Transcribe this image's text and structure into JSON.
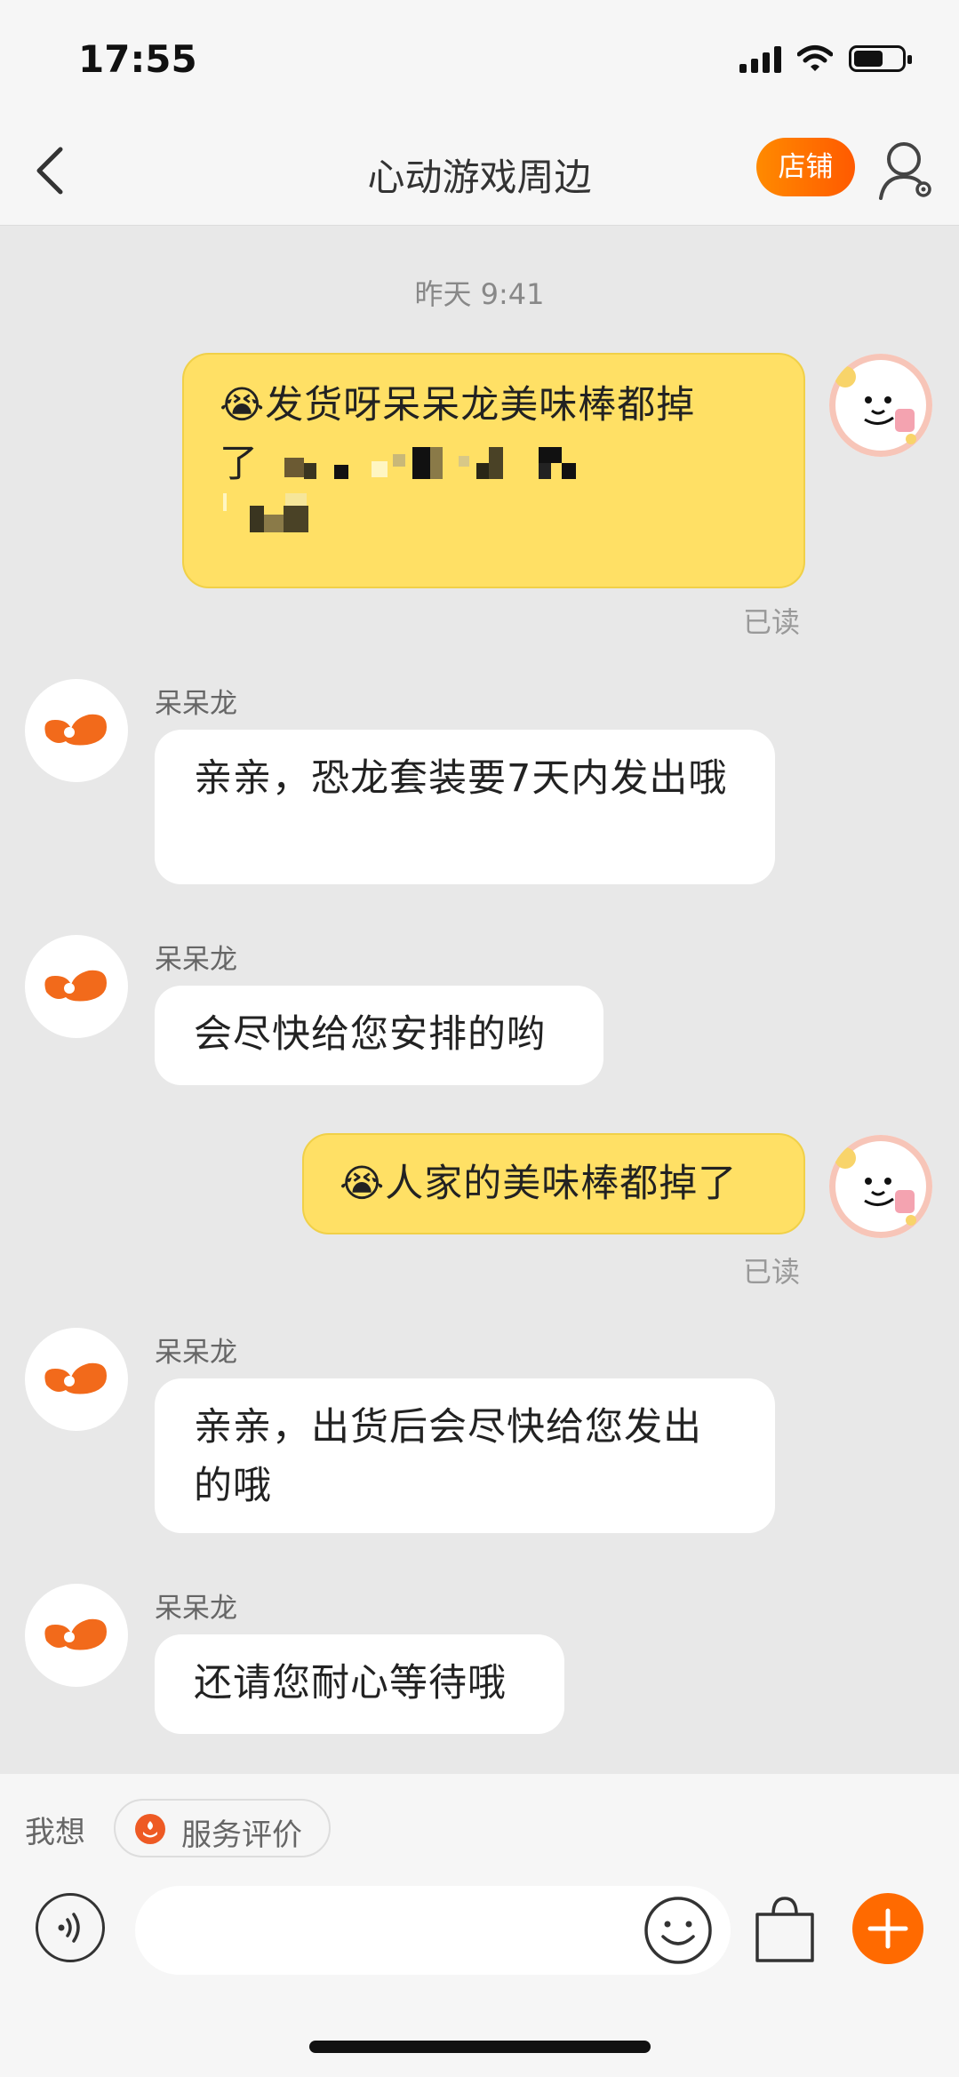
{
  "status_bar": {
    "time": "17:55"
  },
  "nav": {
    "title": "心动游戏周边",
    "shop_button": "店铺"
  },
  "chat": {
    "timestamp": "昨天 9:41",
    "messages": [
      {
        "from": "me",
        "text_line1": "😭发货呀呆呆龙美味棒都掉",
        "text_line2_prefix": "了",
        "read": "已读"
      },
      {
        "from": "shop",
        "sender": "呆呆龙",
        "text": "亲亲，恐龙套装要7天内发出哦"
      },
      {
        "from": "shop",
        "sender": "呆呆龙",
        "text": "会尽快给您安排的哟"
      },
      {
        "from": "me",
        "text": "😭人家的美味棒都掉了",
        "read": "已读"
      },
      {
        "from": "shop",
        "sender": "呆呆龙",
        "text": "亲亲，出货后会尽快给您发出的哦"
      },
      {
        "from": "shop",
        "sender": "呆呆龙",
        "text": "还请您耐心等待哦"
      }
    ]
  },
  "quick": {
    "label": "我想",
    "chip": "服务评价"
  },
  "input": {
    "value": "",
    "icons": [
      "voice-icon",
      "emoji-icon",
      "shopping-bag-icon",
      "plus-icon"
    ]
  },
  "colors": {
    "accent": "#ff6a00",
    "my_bubble": "#ffe065",
    "their_bubble": "#ffffff",
    "background": "#e8e8e8"
  }
}
